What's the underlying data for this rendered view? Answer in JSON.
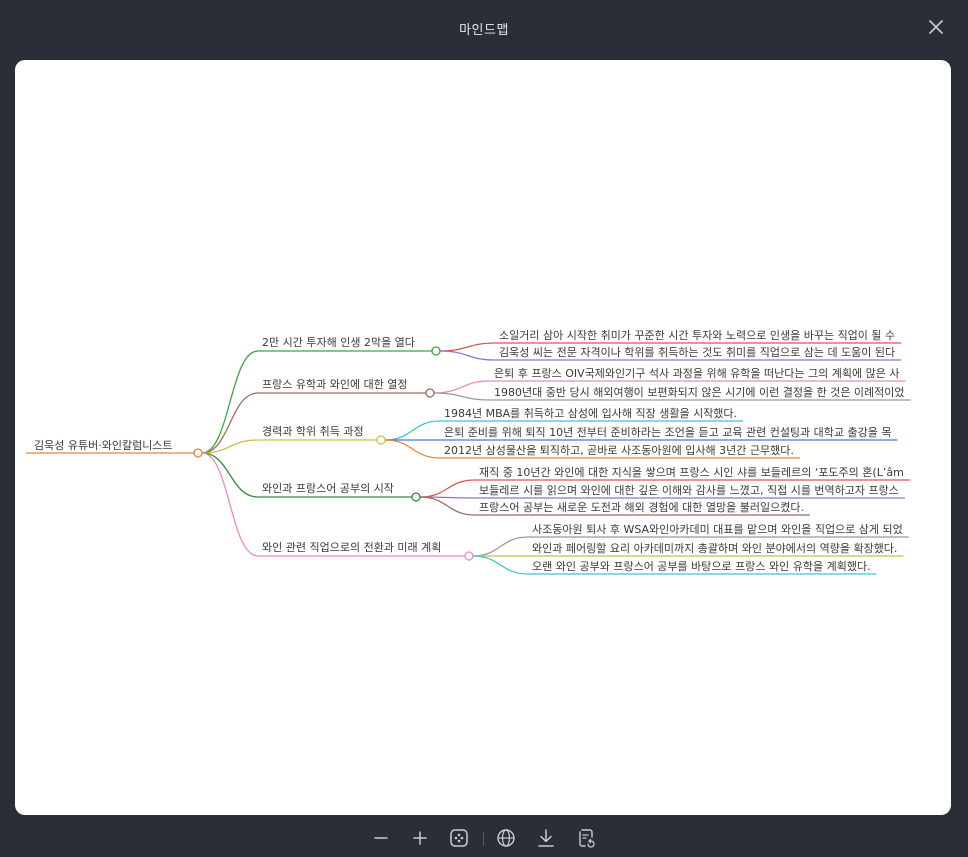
{
  "window": {
    "title": "마인드맵"
  },
  "mindmap": {
    "root": {
      "label": "김욱성 유튜버·와인칼럼니스트",
      "color": "#e8833a"
    },
    "branches": [
      {
        "label": "2만 시간 투자해 인생 2막을 열다",
        "color": "#3fa33f",
        "leaves": [
          {
            "text": "소일거리 삼아 시작한 취미가 꾸준한 시간 투자와 노력으로 인생을 바꾸는 직업이 될 수",
            "color": "#e05252"
          },
          {
            "text": "김욱성 씨는 전문 자격이나 학위를 취득하는 것도 취미를 직업으로 삼는 데 도움이 된다",
            "color": "#9a6fc7"
          }
        ]
      },
      {
        "label": "프랑스 유학과 와인에 대한 열정",
        "color": "#9b6a5e",
        "leaves": [
          {
            "text": "은퇴 후 프랑스 OIV국제와인기구 석사 과정을 위해 유학을 떠난다는 그의 계획에 많은 사",
            "color": "#e98ac8"
          },
          {
            "text": "1980년대 중반 당시 해외여행이 보편화되지 않은 시기에 이런 결정을 한 것은 이례적이었",
            "color": "#9a9a9a"
          }
        ]
      },
      {
        "label": "경력과 학위 취득 과정",
        "color": "#c8c23a",
        "leaves": [
          {
            "text": "1984년 MBA를 취득하고 삼성에 입사해 직장 생활을 시작했다.",
            "color": "#3cc3d8"
          },
          {
            "text": "은퇴 준비를 위해 퇴직 10년 전부터 준비하라는 조언을 듣고 교육 관련 컨설팅과 대학교 출강을 목",
            "color": "#3a7fd8"
          },
          {
            "text": "2012년 삼성물산을 퇴직하고, 곧바로 사조동아원에 입사해 3년간 근무했다.",
            "color": "#e8833a"
          }
        ]
      },
      {
        "label": "와인과 프랑스어 공부의 시작",
        "color": "#2f8f3a",
        "leaves": [
          {
            "text": "재직 중 10년간 와인에 대한 지식을 쌓으며 프랑스 시인 샤를 보들레르의 ‘포도주의 혼(L’âm",
            "color": "#e05252"
          },
          {
            "text": "보들레르 시를 읽으며 와인에 대한 깊은 이해와 감사를 느꼈고, 직접 시를 번역하고자 프랑스",
            "color": "#9a6fc7"
          },
          {
            "text": "프랑스어 공부는 새로운 도전과 해외 경험에 대한 열망을 불러일으켰다.",
            "color": "#9b6a5e"
          }
        ]
      },
      {
        "label": "와인 관련 직업으로의 전환과 미래 계획",
        "color": "#e98ac8",
        "leaves": [
          {
            "text": "사조동아원 퇴사 후 WSA와인아카데미 대표를 맡으며 와인을 직업으로 삼게 되었",
            "color": "#9a9a9a"
          },
          {
            "text": "와인과 페어링할 요리 아카데미까지 총괄하며 와인 분야에서의 역량을 확장했다.",
            "color": "#c8c23a"
          },
          {
            "text": "오랜 와인 공부와 프랑스어 공부를 바탕으로 프랑스 와인 유학을 계획했다.",
            "color": "#3cc3d8"
          }
        ]
      }
    ]
  },
  "toolbar": {
    "icons": [
      "zoom-out-icon",
      "zoom-in-icon",
      "fit-view-icon",
      "globe-icon",
      "download-icon",
      "export-icon"
    ],
    "icon_color": "#c9ccd4"
  }
}
